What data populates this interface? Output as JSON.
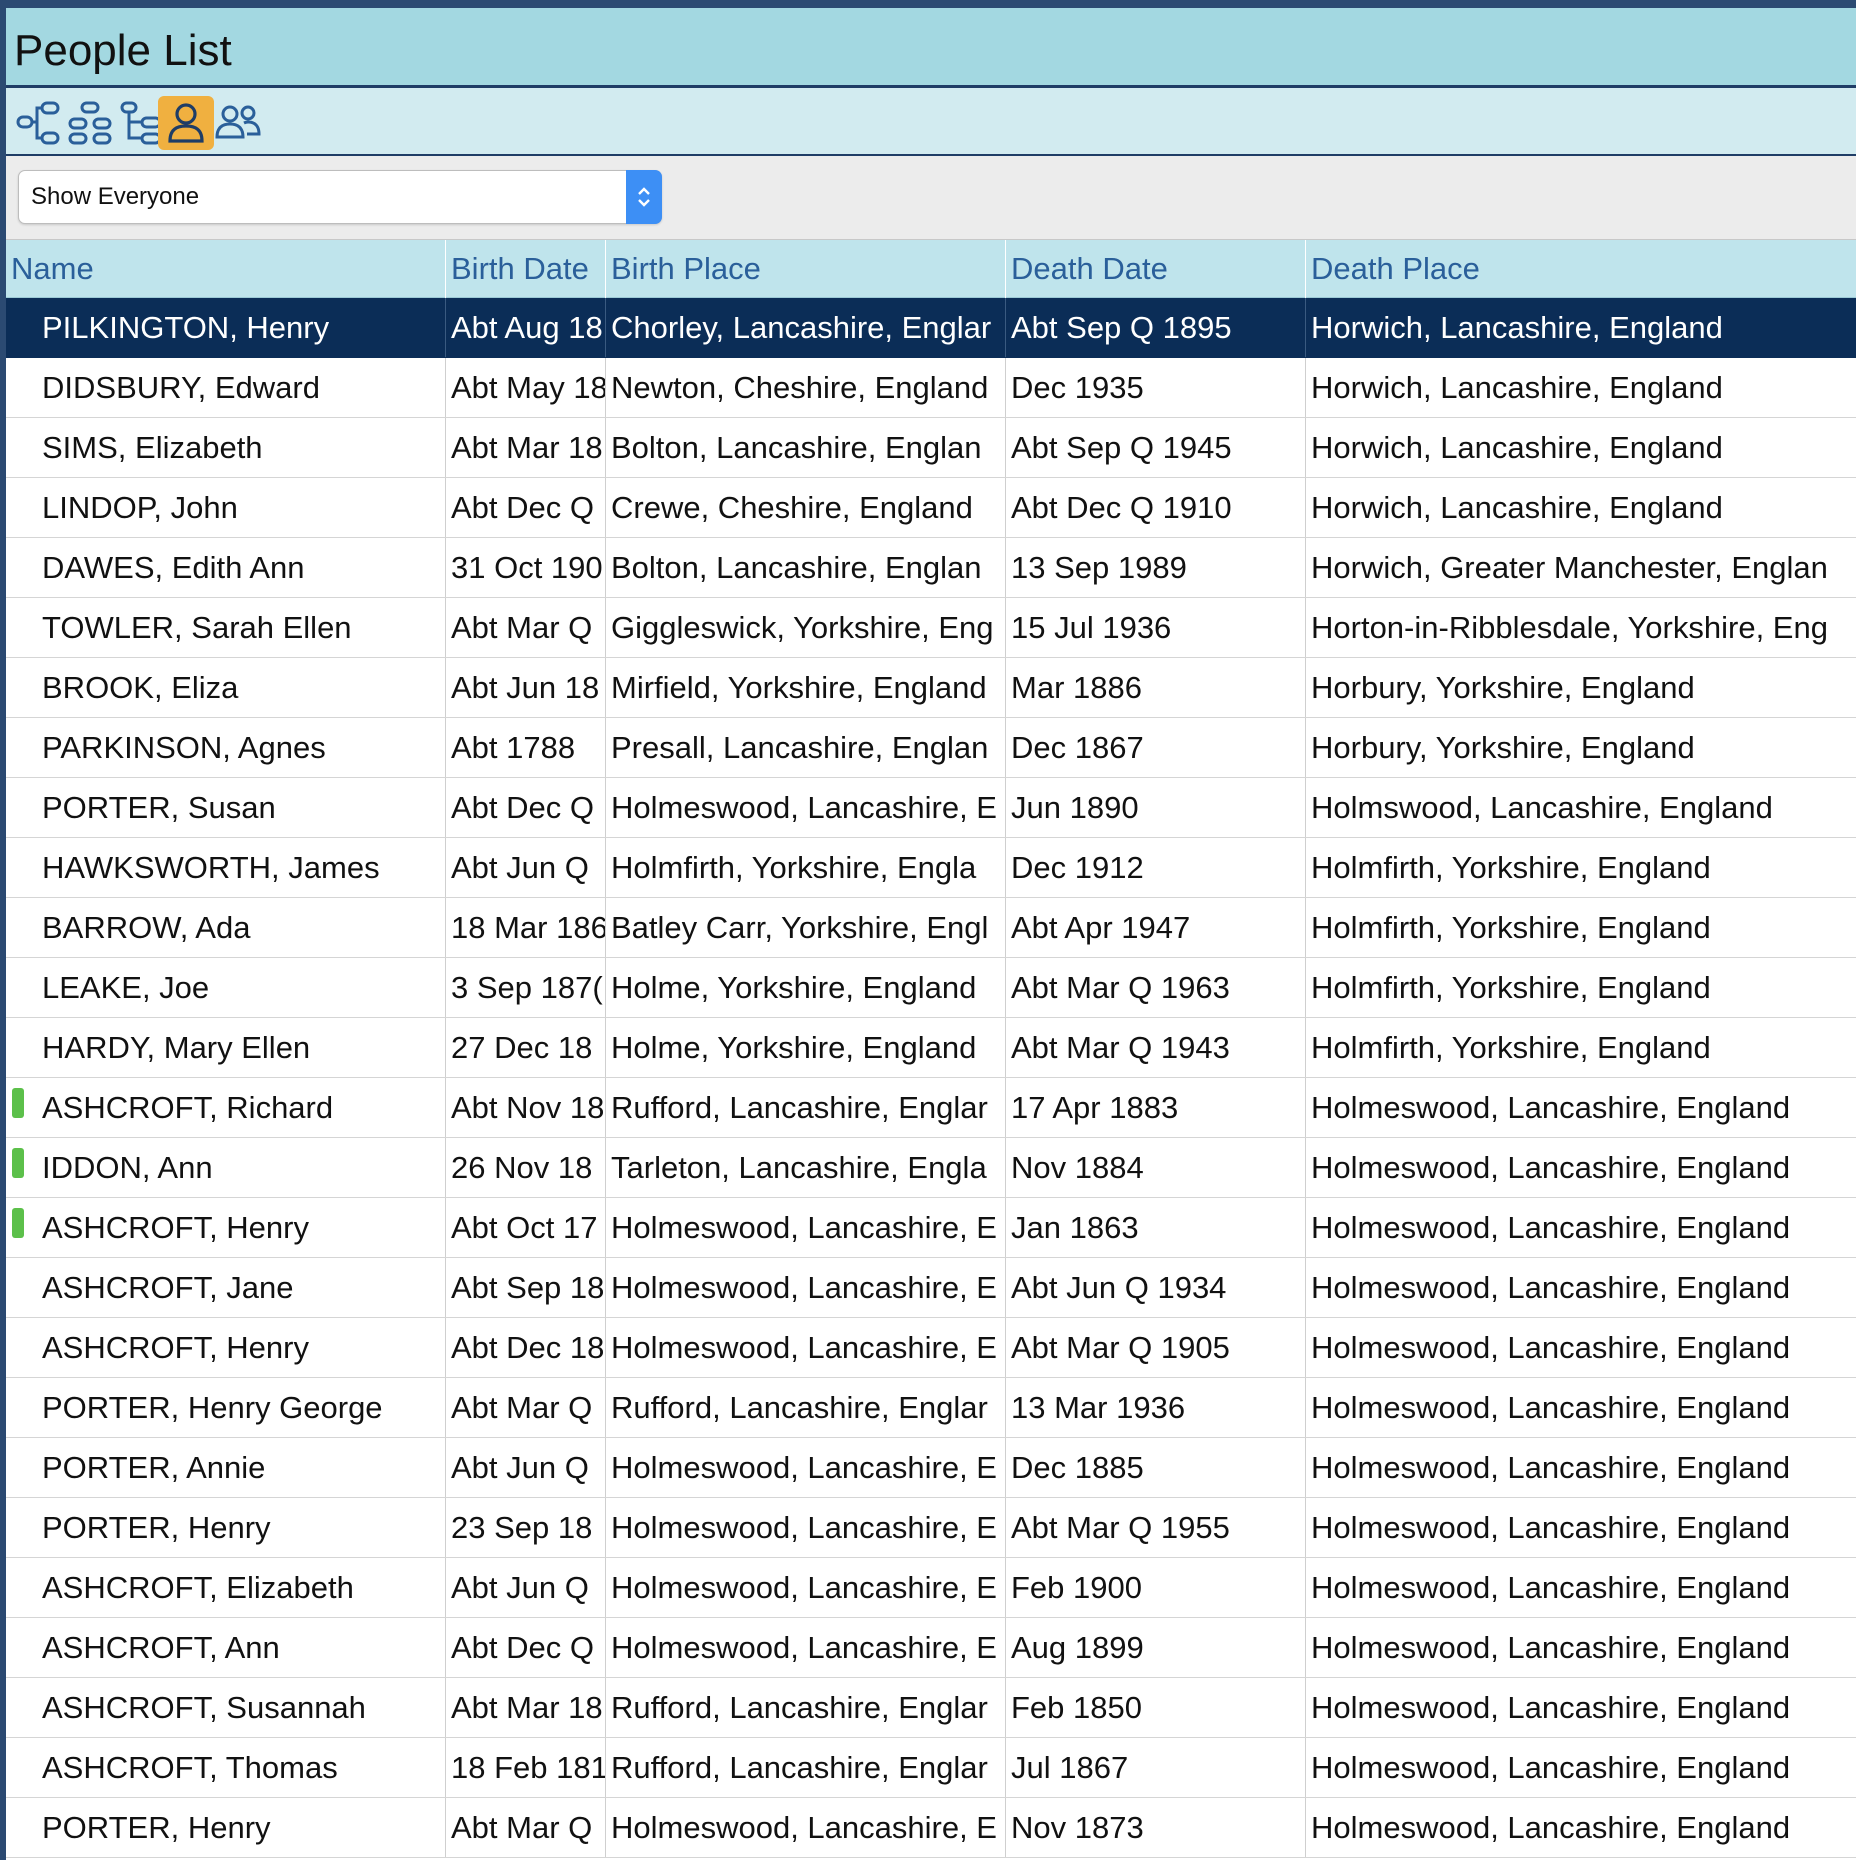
{
  "window": {
    "title": "People List"
  },
  "toolbar": {
    "buttons": [
      {
        "icon": "pedigree-tree-icon",
        "active": false
      },
      {
        "icon": "descendant-tree-icon",
        "active": false
      },
      {
        "icon": "hierarchy-tree-icon",
        "active": false
      },
      {
        "icon": "single-person-icon",
        "active": true
      },
      {
        "icon": "two-people-icon",
        "active": false
      }
    ],
    "active_color": "#f0b040"
  },
  "filter": {
    "selected": "Show Everyone"
  },
  "table": {
    "columns": [
      "Name",
      "Birth Date",
      "Birth Place",
      "Death Date",
      "Death Place"
    ],
    "selected_row_color": "#0b2d57",
    "marker_color": "#5cc04a",
    "rows": [
      {
        "name": "PILKINGTON, Henry",
        "birth_date": "Abt Aug 18",
        "birth_place": "Chorley, Lancashire, Englar",
        "death_date": "Abt Sep Q 1895",
        "death_place": "Horwich, Lancashire, England",
        "selected": true,
        "marker": false
      },
      {
        "name": "DIDSBURY, Edward",
        "birth_date": "Abt May 18",
        "birth_place": "Newton, Cheshire, England",
        "death_date": "Dec 1935",
        "death_place": "Horwich, Lancashire, England",
        "selected": false,
        "marker": false
      },
      {
        "name": "SIMS, Elizabeth",
        "birth_date": "Abt Mar 18",
        "birth_place": "Bolton, Lancashire, Englan",
        "death_date": "Abt Sep Q 1945",
        "death_place": "Horwich, Lancashire, England",
        "selected": false,
        "marker": false
      },
      {
        "name": "LINDOP, John",
        "birth_date": "Abt Dec Q",
        "birth_place": "Crewe, Cheshire, England",
        "death_date": "Abt Dec Q 1910",
        "death_place": "Horwich, Lancashire, England",
        "selected": false,
        "marker": false
      },
      {
        "name": "DAWES, Edith Ann",
        "birth_date": "31 Oct 190",
        "birth_place": "Bolton, Lancashire, Englan",
        "death_date": "13 Sep 1989",
        "death_place": "Horwich, Greater Manchester, Englan",
        "selected": false,
        "marker": false
      },
      {
        "name": "TOWLER, Sarah Ellen",
        "birth_date": "Abt Mar Q",
        "birth_place": "Giggleswick, Yorkshire, Eng",
        "death_date": "15 Jul 1936",
        "death_place": "Horton-in-Ribblesdale, Yorkshire, Eng",
        "selected": false,
        "marker": false
      },
      {
        "name": "BROOK, Eliza",
        "birth_date": "Abt Jun 18",
        "birth_place": "Mirfield, Yorkshire, England",
        "death_date": "Mar 1886",
        "death_place": "Horbury, Yorkshire, England",
        "selected": false,
        "marker": false
      },
      {
        "name": "PARKINSON, Agnes",
        "birth_date": "Abt 1788",
        "birth_place": "Presall, Lancashire, Englan",
        "death_date": "Dec 1867",
        "death_place": "Horbury, Yorkshire, England",
        "selected": false,
        "marker": false
      },
      {
        "name": "PORTER, Susan",
        "birth_date": "Abt Dec Q",
        "birth_place": "Holmeswood, Lancashire, E",
        "death_date": "Jun 1890",
        "death_place": "Holmswood, Lancashire, England",
        "selected": false,
        "marker": false
      },
      {
        "name": "HAWKSWORTH, James",
        "birth_date": "Abt Jun Q",
        "birth_place": "Holmfirth, Yorkshire, Engla",
        "death_date": "Dec 1912",
        "death_place": "Holmfirth, Yorkshire, England",
        "selected": false,
        "marker": false
      },
      {
        "name": "BARROW, Ada",
        "birth_date": "18 Mar 186",
        "birth_place": "Batley Carr, Yorkshire, Engl",
        "death_date": "Abt Apr 1947",
        "death_place": "Holmfirth, Yorkshire, England",
        "selected": false,
        "marker": false
      },
      {
        "name": "LEAKE, Joe",
        "birth_date": "3 Sep 187(",
        "birth_place": "Holme, Yorkshire, England",
        "death_date": "Abt Mar Q 1963",
        "death_place": "Holmfirth, Yorkshire, England",
        "selected": false,
        "marker": false
      },
      {
        "name": "HARDY, Mary Ellen",
        "birth_date": "27 Dec 18",
        "birth_place": "Holme, Yorkshire, England",
        "death_date": "Abt Mar Q 1943",
        "death_place": "Holmfirth, Yorkshire, England",
        "selected": false,
        "marker": false
      },
      {
        "name": "ASHCROFT, Richard",
        "birth_date": "Abt Nov 18",
        "birth_place": "Rufford, Lancashire, Englar",
        "death_date": "17 Apr 1883",
        "death_place": "Holmeswood, Lancashire, England",
        "selected": false,
        "marker": true
      },
      {
        "name": "IDDON, Ann",
        "birth_date": "26 Nov 18",
        "birth_place": "Tarleton, Lancashire, Engla",
        "death_date": "Nov 1884",
        "death_place": "Holmeswood, Lancashire, England",
        "selected": false,
        "marker": true
      },
      {
        "name": "ASHCROFT, Henry",
        "birth_date": "Abt Oct 17",
        "birth_place": "Holmeswood, Lancashire, E",
        "death_date": "Jan 1863",
        "death_place": "Holmeswood, Lancashire, England",
        "selected": false,
        "marker": true
      },
      {
        "name": "ASHCROFT, Jane",
        "birth_date": "Abt Sep 18",
        "birth_place": "Holmeswood, Lancashire, E",
        "death_date": "Abt Jun Q 1934",
        "death_place": "Holmeswood, Lancashire, England",
        "selected": false,
        "marker": false
      },
      {
        "name": "ASHCROFT, Henry",
        "birth_date": "Abt Dec 18",
        "birth_place": "Holmeswood, Lancashire, E",
        "death_date": "Abt Mar Q 1905",
        "death_place": "Holmeswood, Lancashire, England",
        "selected": false,
        "marker": false
      },
      {
        "name": "PORTER, Henry George",
        "birth_date": "Abt Mar Q",
        "birth_place": "Rufford, Lancashire, Englar",
        "death_date": "13 Mar 1936",
        "death_place": "Holmeswood, Lancashire, England",
        "selected": false,
        "marker": false
      },
      {
        "name": "PORTER, Annie",
        "birth_date": "Abt Jun Q",
        "birth_place": "Holmeswood, Lancashire, E",
        "death_date": "Dec 1885",
        "death_place": "Holmeswood, Lancashire, England",
        "selected": false,
        "marker": false
      },
      {
        "name": "PORTER, Henry",
        "birth_date": "23 Sep 18",
        "birth_place": "Holmeswood, Lancashire, E",
        "death_date": "Abt Mar Q 1955",
        "death_place": "Holmeswood, Lancashire, England",
        "selected": false,
        "marker": false
      },
      {
        "name": "ASHCROFT, Elizabeth",
        "birth_date": "Abt Jun Q",
        "birth_place": "Holmeswood, Lancashire, E",
        "death_date": "Feb 1900",
        "death_place": "Holmeswood, Lancashire, England",
        "selected": false,
        "marker": false
      },
      {
        "name": "ASHCROFT, Ann",
        "birth_date": "Abt Dec Q",
        "birth_place": "Holmeswood, Lancashire, E",
        "death_date": "Aug 1899",
        "death_place": "Holmeswood, Lancashire, England",
        "selected": false,
        "marker": false
      },
      {
        "name": "ASHCROFT, Susannah",
        "birth_date": "Abt Mar 18",
        "birth_place": "Rufford, Lancashire, Englar",
        "death_date": "Feb 1850",
        "death_place": "Holmeswood, Lancashire, England",
        "selected": false,
        "marker": false
      },
      {
        "name": "ASHCROFT, Thomas",
        "birth_date": "18 Feb 181",
        "birth_place": "Rufford, Lancashire, Englar",
        "death_date": "Jul 1867",
        "death_place": "Holmeswood, Lancashire, England",
        "selected": false,
        "marker": false
      },
      {
        "name": "PORTER, Henry",
        "birth_date": "Abt Mar Q",
        "birth_place": "Holmeswood, Lancashire, E",
        "death_date": "Nov 1873",
        "death_place": "Holmeswood, Lancashire, England",
        "selected": false,
        "marker": false
      }
    ]
  }
}
